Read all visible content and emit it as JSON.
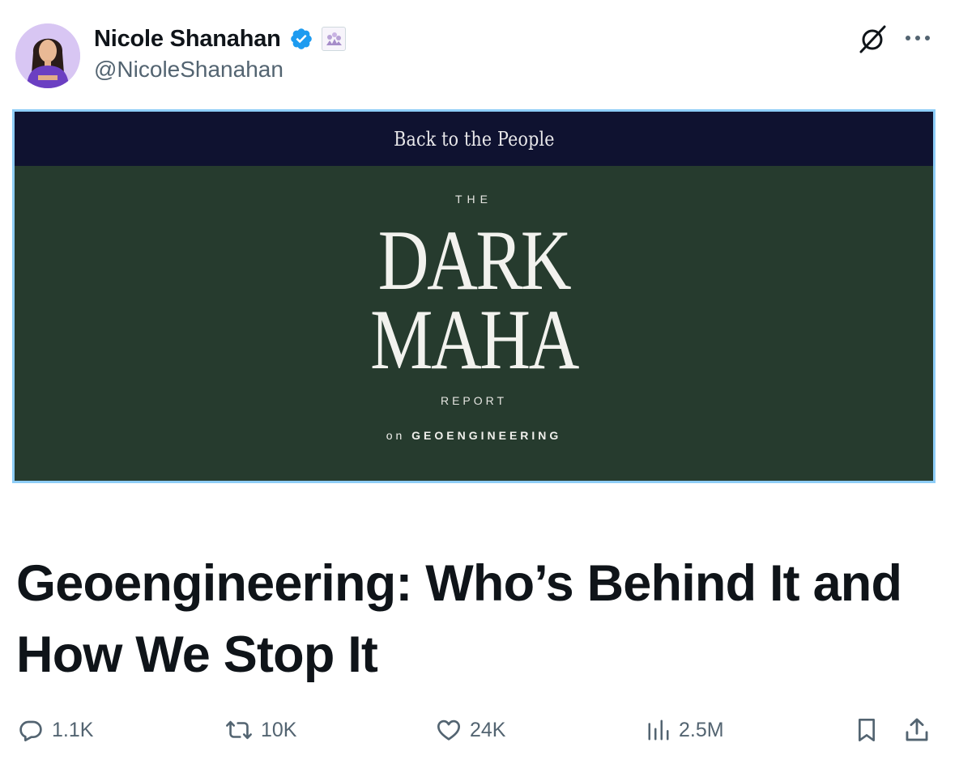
{
  "author": {
    "display_name": "Nicole Shanahan",
    "handle": "@NicoleShanahan",
    "verified": true,
    "verified_color": "#1d9bf0"
  },
  "header_icons": [
    "grok-icon",
    "more-icon"
  ],
  "cover": {
    "band_text": "Back to the People",
    "the": "THE",
    "title_line1": "DARK",
    "title_line2": "MAHA",
    "report": "REPORT",
    "sub_on": "on",
    "sub_topic": "GEOENGINEERING",
    "band_color": "#0f1230",
    "background_color": "#263b2e"
  },
  "article": {
    "title": "Geoengineering: Who’s Behind It and How We Stop It"
  },
  "actions": {
    "replies": "1.1K",
    "reposts": "10K",
    "likes": "24K",
    "views": "2.5M"
  }
}
